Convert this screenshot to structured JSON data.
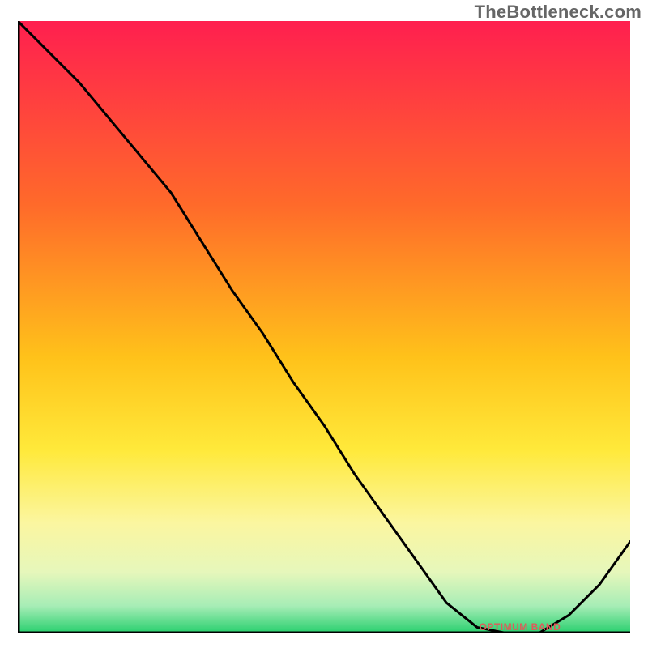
{
  "branding": {
    "watermark": "TheBottleneck.com"
  },
  "chart_data": {
    "type": "line",
    "title": "",
    "xlabel": "",
    "ylabel": "",
    "xlim": [
      0,
      100
    ],
    "ylim": [
      0,
      100
    ],
    "grid": false,
    "x": [
      0,
      5,
      10,
      15,
      20,
      25,
      30,
      35,
      40,
      45,
      50,
      55,
      60,
      65,
      70,
      75,
      80,
      85,
      90,
      95,
      100
    ],
    "values": [
      100,
      95,
      90,
      84,
      78,
      72,
      64,
      56,
      49,
      41,
      34,
      26,
      19,
      12,
      5,
      1,
      0,
      0,
      3,
      8,
      15
    ],
    "annotations": [
      {
        "label_approx": "OPTIMUM BAND",
        "x": 82,
        "y": 0.5
      }
    ],
    "background_gradient": [
      {
        "stop": 0.0,
        "color": "#ff1f4f"
      },
      {
        "stop": 0.3,
        "color": "#ff6a2a"
      },
      {
        "stop": 0.55,
        "color": "#ffc21a"
      },
      {
        "stop": 0.7,
        "color": "#ffe93a"
      },
      {
        "stop": 0.82,
        "color": "#fbf6a0"
      },
      {
        "stop": 0.9,
        "color": "#e6f7bb"
      },
      {
        "stop": 0.955,
        "color": "#a7edb6"
      },
      {
        "stop": 1.0,
        "color": "#26cf6d"
      }
    ],
    "line_color": "#000000",
    "annotation_color": "#e05a5a",
    "axis_color": "#000000"
  }
}
